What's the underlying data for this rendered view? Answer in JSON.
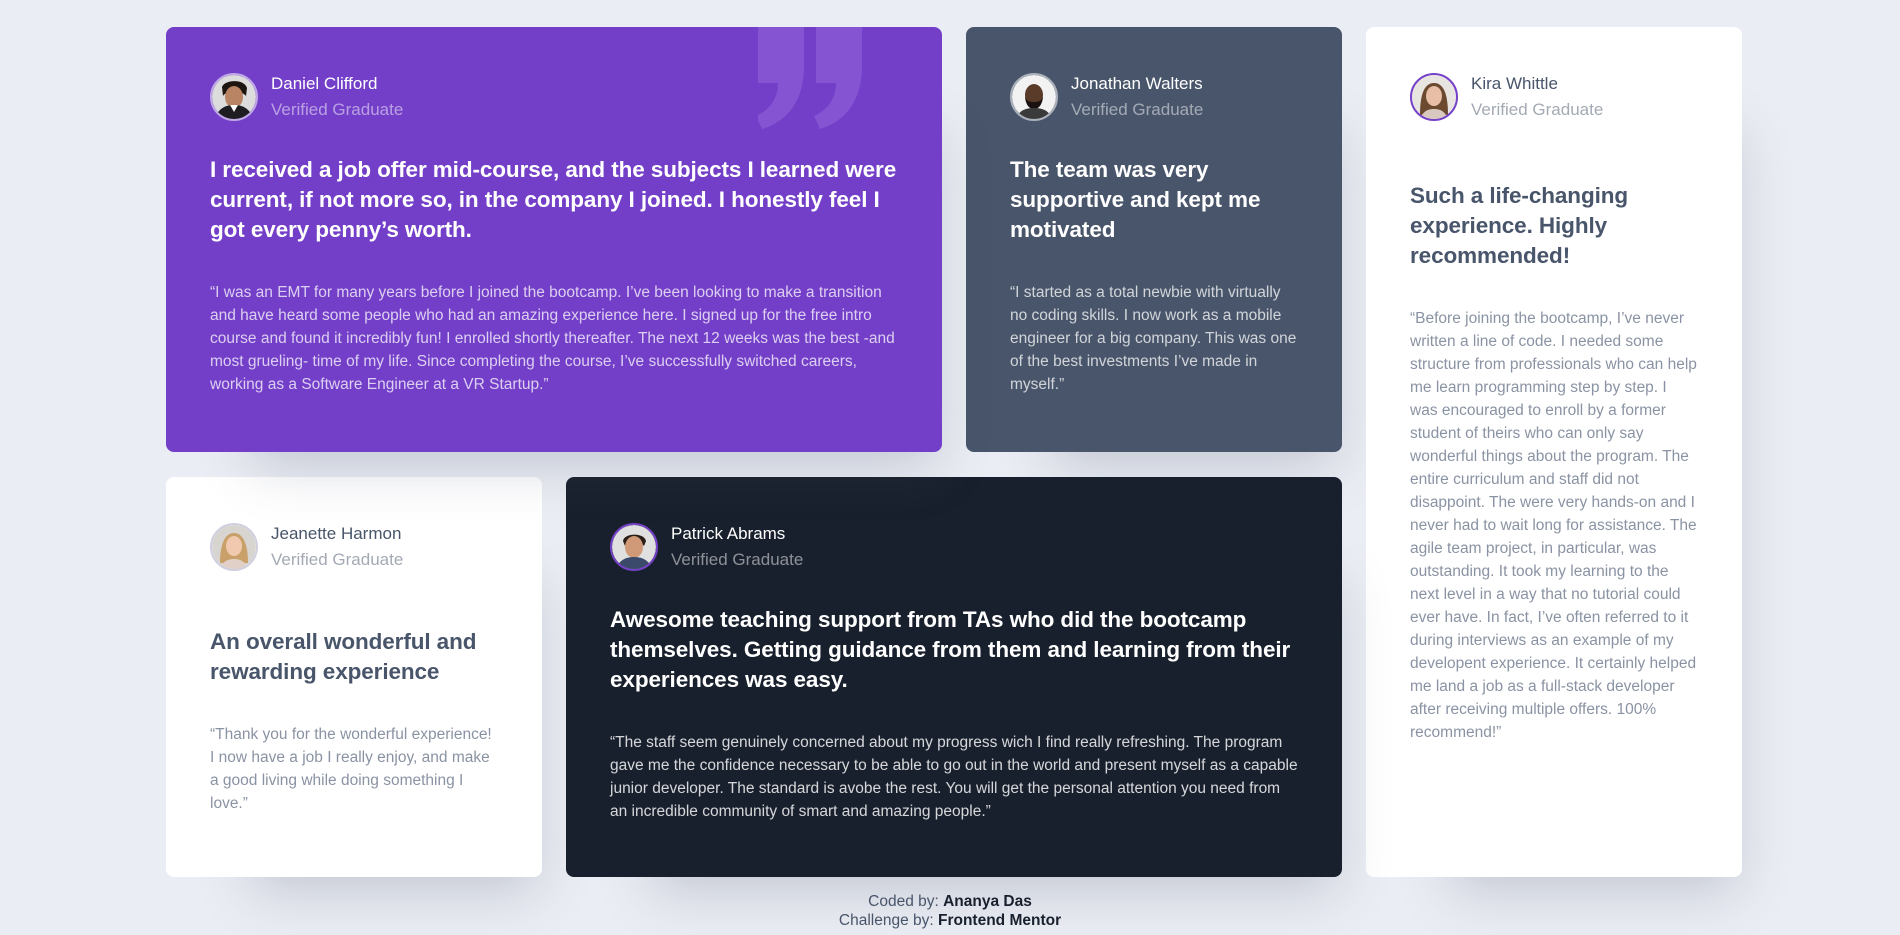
{
  "colors": {
    "background": "#ebedf4",
    "moderate_violet": "#733fc8",
    "grayish_blue": "#48556a",
    "very_dark_blackish_blue": "#19202d",
    "white": "#ffffff"
  },
  "testimonials": [
    {
      "name": "Daniel Clifford",
      "status": "Verified Graduate",
      "headline": "I received a job offer mid-course, and the subjects I learned were current, if not more so, in the company I joined. I honestly feel I got every penny’s worth.",
      "body": "“I was an EMT for many years before I joined the bootcamp. I’ve been looking to make a transition and have heard some people who had an amazing experience here. I signed up for the free intro course and found it incredibly fun! I enrolled shortly thereafter. The next 12 weeks was the best -and most grueling- time of my life. Since completing the course, I’ve successfully switched careers, working as a Software Engineer at a VR Startup.”",
      "avatar_icon": "avatar-daniel-icon"
    },
    {
      "name": "Jonathan Walters",
      "status": "Verified Graduate",
      "headline": "The team was very supportive and kept me motivated",
      "body": "“I started as a total newbie with virtually no coding skills. I now work as a mobile engineer for a big company. This was one of the best investments I’ve made in myself.”",
      "avatar_icon": "avatar-jonathan-icon"
    },
    {
      "name": "Kira Whittle",
      "status": "Verified Graduate",
      "headline": "Such a life-changing experience. Highly recommended!",
      "body": "“Before joining the bootcamp, I’ve never written a line of code. I needed some structure from professionals who can help me learn programming step by step. I was encouraged to enroll by a former student of theirs who can only say wonderful things about the program. The entire curriculum and staff did not disappoint. The were very hands-on and I never had to wait long for assistance. The agile team project, in particular, was outstanding. It took my learning to the next level in a way that no tutorial could ever have. In fact, I’ve often referred to it during interviews as an example of my developent experience. It certainly helped me land a job as a full-stack developer after receiving multiple offers. 100% recommend!”",
      "avatar_icon": "avatar-kira-icon"
    },
    {
      "name": "Jeanette Harmon",
      "status": "Verified Graduate",
      "headline": "An overall wonderful and rewarding experience",
      "body": "“Thank you for the wonderful experience! I now have a job I really enjoy, and make a good living while doing something I love.”",
      "avatar_icon": "avatar-jeanette-icon"
    },
    {
      "name": "Patrick Abrams",
      "status": "Verified Graduate",
      "headline": "Awesome teaching support from TAs who did the bootcamp themselves. Getting guidance from them and learning from their experiences was easy.",
      "body": "“The staff seem genuinely concerned about my progress wich I find really refreshing. The program gave me the confidence necessary to be able to go out in the world and present myself as a capable junior developer. The standard is avobe the rest. You will get the personal attention you need from an incredible community of smart and amazing people.”",
      "avatar_icon": "avatar-patrick-icon"
    }
  ],
  "attribution": {
    "coded_by_label": "Coded by: ",
    "coded_by_name": "Ananya Das",
    "challenge_by_label": "Challenge by: ",
    "challenge_by_name": "Frontend Mentor"
  }
}
